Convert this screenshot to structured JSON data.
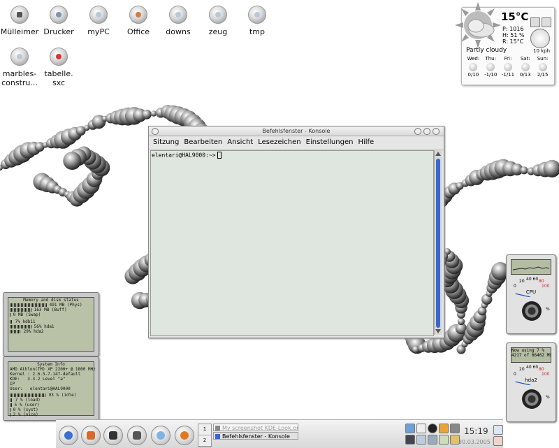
{
  "desktop": {
    "icons": [
      {
        "label": "Mülleimer",
        "icon": "trash-icon"
      },
      {
        "label": "Drucker",
        "icon": "printer-icon"
      },
      {
        "label": "myPC",
        "icon": "computer-icon"
      },
      {
        "label": "Office",
        "icon": "office-icon"
      },
      {
        "label": "downs",
        "icon": "folder-icon"
      },
      {
        "label": "zeug",
        "icon": "folder-icon"
      },
      {
        "label": "tmp",
        "icon": "folder-icon"
      },
      {
        "label": "marbles-\nconstru...",
        "icon": "folder-icon"
      },
      {
        "label": "tabelle.\nsxc",
        "icon": "spreadsheet-icon"
      }
    ]
  },
  "weather": {
    "temperature": "15°C",
    "pressure": "P: 1016",
    "humidity": "H: 51 %",
    "realfeel": "R: 15°C",
    "condition": "Partly cloudy",
    "wind": "10 kph",
    "forecast": [
      {
        "day": "Wed:",
        "temps": "0/10"
      },
      {
        "day": "Thu:",
        "temps": "-1/10"
      },
      {
        "day": "Fri:",
        "temps": "-1/11"
      },
      {
        "day": "Sat:",
        "temps": "0/13"
      },
      {
        "day": "Sun:",
        "temps": "2/15"
      }
    ]
  },
  "konsole": {
    "title": "Befehlsfenster - Konsole",
    "menu": [
      "Sitzung",
      "Bearbeiten",
      "Ansicht",
      "Lesezeichen",
      "Einstellungen",
      "Hilfe"
    ],
    "prompt": "elentari@HAL9000:~>"
  },
  "memory_widget": {
    "title": "Memory and disk status",
    "rows": [
      {
        "value": "491",
        "label": "MB (Phys)",
        "level": 0.95
      },
      {
        "value": "163",
        "label": "MB (Buff)",
        "level": 0.55
      },
      {
        "value": "0",
        "label": "MB (Swap)",
        "level": 0.02
      },
      {
        "value": "7%",
        "label": "hdb11",
        "level": 0.07
      },
      {
        "value": "56%",
        "label": "hda1",
        "level": 0.56
      },
      {
        "value": "29%",
        "label": "hda2",
        "level": 0.29
      }
    ]
  },
  "sysinfo_widget": {
    "title": "System Info",
    "cpu": "AMD Athlon(TM) XP 2200+ @ 1800 MHz",
    "kernel": "Kernel : 2.6.5-7.147-default",
    "kde": "KDE:   3.3.2 Level \"a\"",
    "ip": "IP",
    "user": "User:   elentari@HAL9000",
    "rows": [
      {
        "value": "93",
        "label": "% (idle)",
        "level": 0.93
      },
      {
        "value": "7",
        "label": "% (load)",
        "level": 0.07
      },
      {
        "value": "5",
        "label": "% (user)",
        "level": 0.05
      },
      {
        "value": "0",
        "label": "% (syst)",
        "level": 0.0
      },
      {
        "value": "2",
        "label": "% (nice)",
        "level": 0.02
      }
    ]
  },
  "gauges": [
    {
      "display": "",
      "label": "CPU",
      "scale": [
        "0",
        "20",
        "40 60",
        "80",
        "100"
      ],
      "level": 0.07
    },
    {
      "display": "Now using 7 %\n4217 of 66462 Mb",
      "label": "hda2",
      "scale": [
        "0",
        "20",
        "40 60",
        "80",
        "100"
      ],
      "level": 0.07
    }
  ],
  "taskbar": {
    "pager": [
      "1",
      "2"
    ],
    "tasks": [
      {
        "label": "My screenshot KDE-Look.org",
        "state": "inactive"
      },
      {
        "label": "Befehlsfenster - Konsole",
        "state": "active"
      }
    ],
    "clock": "15:19",
    "date": "30.03.2005"
  },
  "colors": {
    "accent": "#3b66ce",
    "lcd": "#b9c1a7"
  }
}
